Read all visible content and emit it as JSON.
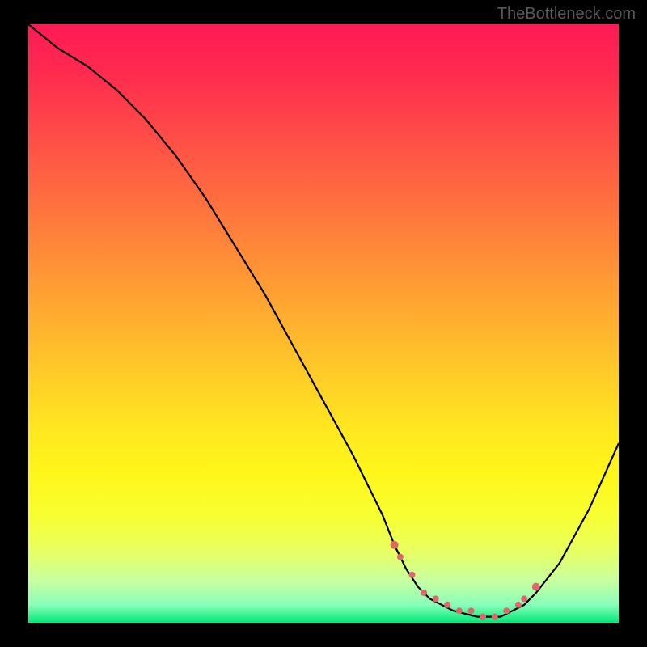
{
  "watermark": "TheBottleneck.com",
  "chart_data": {
    "type": "line",
    "title": "",
    "xlabel": "",
    "ylabel": "",
    "xlim": [
      0,
      100
    ],
    "ylim": [
      0,
      100
    ],
    "series": [
      {
        "name": "bottleneck-curve",
        "x": [
          0,
          5,
          10,
          15,
          20,
          25,
          30,
          35,
          40,
          45,
          50,
          55,
          60,
          62,
          64,
          66,
          68,
          72,
          76,
          80,
          82,
          84,
          86,
          90,
          95,
          100
        ],
        "y": [
          100,
          96,
          93,
          89,
          84,
          78,
          71,
          63,
          55,
          46,
          37,
          28,
          18,
          13,
          9,
          6,
          4,
          2,
          1,
          1,
          2,
          3,
          5,
          10,
          19,
          30
        ]
      }
    ],
    "markers": {
      "name": "highlight-points",
      "color": "#db6b6b",
      "x": [
        62,
        63,
        65,
        67,
        69,
        71,
        73,
        75,
        77,
        79,
        81,
        83,
        84,
        86
      ],
      "y": [
        13,
        11,
        8,
        5,
        4,
        3,
        2,
        2,
        1,
        1,
        2,
        3,
        4,
        6
      ]
    }
  }
}
